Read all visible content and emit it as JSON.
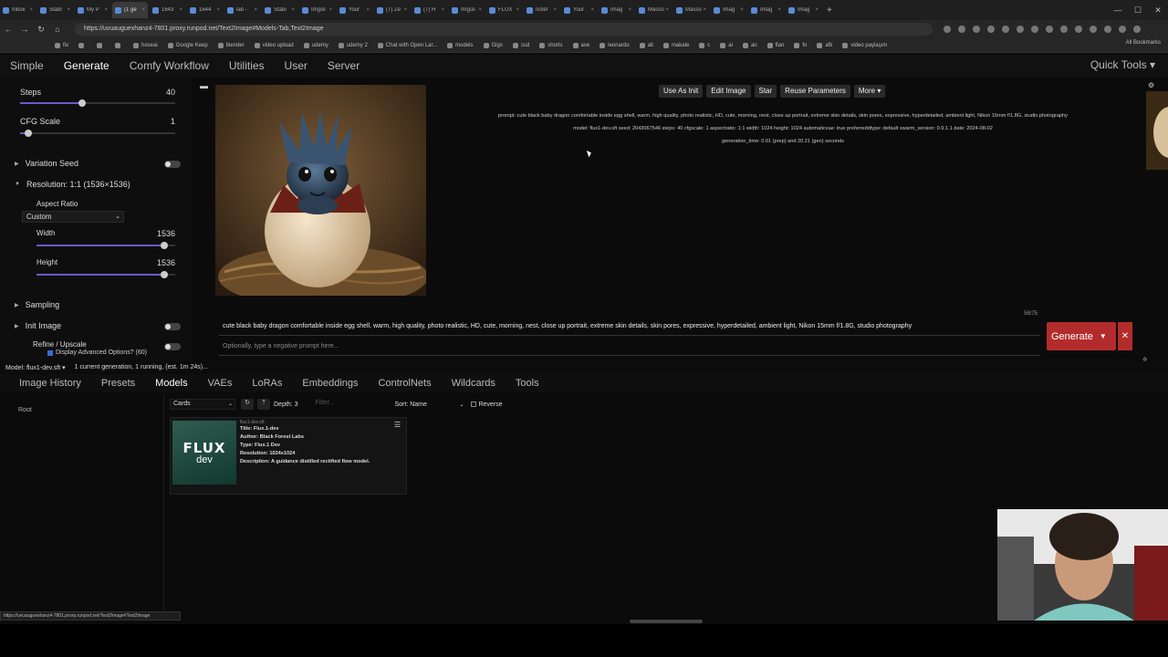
{
  "browser": {
    "tabs": [
      "Inbox",
      "Stabl",
      "My P",
      "(1 ge",
      "1643",
      "1644",
      "lab -",
      "Stabi",
      "Imgsli",
      "Your",
      "(7) Ze",
      "(7) H",
      "Imgsli",
      "FLUX",
      "notef",
      "Your",
      "Imag",
      "Masso",
      "Masso",
      "Imag",
      "Imag",
      "Imag"
    ],
    "url": "https://uvuauguexhanz4-7801.proxy.runpod.net/Text2Image#Models-Tab,Text2Image",
    "bookmarks": [
      "fix",
      "",
      "",
      "",
      "hoseai",
      "Google Keep",
      "blender",
      "video upload",
      "udemy",
      "udemy 2",
      "Chat with Open Lar...",
      "models",
      "Gigs",
      "ssd",
      "shorts",
      "ave",
      "leonardo",
      "alt",
      "makale",
      "c",
      "ai",
      "an",
      "flan",
      "fo",
      "afk",
      "video paylaşım"
    ],
    "all_bookmarks": "All Bookmarks"
  },
  "nav": {
    "tabs": [
      "Simple",
      "Generate",
      "Comfy Workflow",
      "Utilities",
      "User",
      "Server"
    ],
    "quick_tools": "Quick Tools ▾"
  },
  "left": {
    "steps_label": "Steps",
    "steps_value": "40",
    "steps_fraction": 0.4,
    "cfg_label": "CFG Scale",
    "cfg_value": "1",
    "cfg_fraction": 0.05,
    "variation_seed": "Variation Seed",
    "resolution": "Resolution: 1:1 (1536×1536)",
    "aspect_label": "Aspect Ratio",
    "aspect_value": "Custom",
    "width_label": "Width",
    "width_value": "1536",
    "width_fraction": 0.92,
    "height_label": "Height",
    "height_value": "1536",
    "height_fraction": 0.92,
    "sampling": "Sampling",
    "init_image": "Init Image",
    "refine": "Refine / Upscale",
    "advanced": "Display Advanced Options? (60)"
  },
  "image_buttons": [
    "Use As Init",
    "Edit Image",
    "Star",
    "Reuse Parameters",
    "More ▾"
  ],
  "meta": {
    "line1": "prompt: cute black baby dragon comfortable inside egg shell, warm, high quality, photo realistic, HD, cute, morning, nest, close up portrait, extreme skin details, skin pores, expressive, hyperdetailed, ambient light, Nikon 15mm f/1.8G, studio photography",
    "line2": "model: flux1-dev.sft    seed: 2043067546    steps: 40    cfgscale: 1    aspectratio: 1:1    width: 1024    height: 1024    automaticvae: true    preferreddtype: default    swarm_version: 0.9.1.1    date: 2024-08-02",
    "line3": "generation_time: 0.01 (prep) and 20.21 (gen) seconds"
  },
  "prompt": {
    "text": "cute black baby dragon comfortable inside egg shell, warm, high quality, photo realistic, HD, cute, morning, nest, close up portrait, extreme skin details, skin pores, expressive, hyperdetailed, ambient light, Nikon 15mm f/1.8G, studio photography",
    "negative_placeholder": "Optionally, type a negative prompt here...",
    "token_count": "58/75",
    "generate": "Generate"
  },
  "status": {
    "model": "Model:  flux1-dev.sft ▾",
    "queue": "1 current generation, 1 running, (est. 1m 24s)..."
  },
  "bottom_tabs": [
    "Image History",
    "Presets",
    "Models",
    "VAEs",
    "LoRAs",
    "Embeddings",
    "ControlNets",
    "Wildcards",
    "Tools"
  ],
  "models": {
    "root": "Root",
    "view": "Cards",
    "depth": "Depth: 3",
    "filter_placeholder": "Filter...",
    "sort": "Sort: Name",
    "reverse": "Reverse",
    "card": {
      "filename": "flux1-dev.sft",
      "title": "Title: Flux.1-dev",
      "author": "Author: Black Forest Labs",
      "type": "Type: Flux.1 Dev",
      "resolution": "Resolution: 1024x1024",
      "description": "Description: A guidance distilled rectified flow model.",
      "thumb_line1": "FLUX",
      "thumb_line2": "dev"
    }
  },
  "status_url": "https://uvuauguexhanz4-7801.proxy.runpod.net/Text2Image#Text2Image",
  "colors": {
    "accent": "#b32c2c",
    "slider": "#6a5acd"
  }
}
